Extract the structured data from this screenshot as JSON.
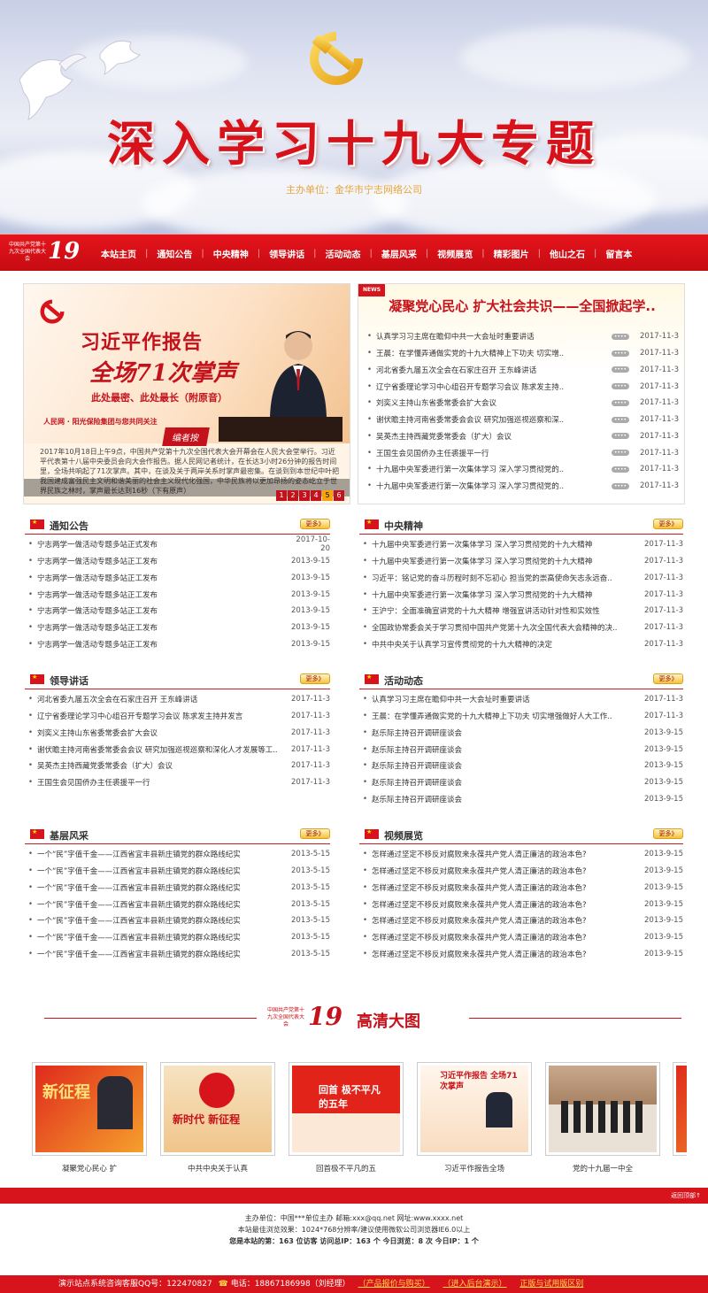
{
  "banner": {
    "title": "深入学习十九大专题",
    "sponsor": "主办单位：金华市宁志网络公司"
  },
  "nav": {
    "logo_text": "中国共产党第十九次全国代表大会",
    "logo_num": "19",
    "items": [
      "本站主页",
      "通知公告",
      "中央精神",
      "领导讲话",
      "活动动态",
      "基层风采",
      "视频展览",
      "精彩图片",
      "他山之石",
      "留言本"
    ]
  },
  "slider": {
    "headline1": "习近平作报告",
    "headline2": "全场71次掌声",
    "headline3": "此处最密、此处最长（附原音）",
    "source": "人民网 · 阳光保险集团与您共同关注",
    "tag": "编者按",
    "text": "2017年10月18日上午9点，中国共产党第十九次全国代表大会开幕会在人民大会堂举行。习近平代表第十八届中央委员会向大会作报告。据人民网记者统计，在长达3小时26分钟的报告时间里，全场共响起了71次掌声。其中，在谈及关于两岸关系时掌声最密集。在谈到到本世纪中叶把我国建成富强民主文明和谐美丽的社会主义现代化强国，中华民族将以更加昂扬的姿态屹立于世界民族之林时，掌声最长达到16秒（下有原声）",
    "pages": [
      "1",
      "2",
      "3",
      "4",
      "5",
      "6"
    ]
  },
  "news": {
    "badge": "NEWS",
    "title": "凝聚党心民心 扩大社会共识——全国掀起学..",
    "items": [
      {
        "title": "认真学习习主席在瞻仰中共一大会址时重要讲话",
        "date": "2017-11-3"
      },
      {
        "title": "王晨：在学懂弄通做实党的十九大精神上下功夫  切实增..",
        "date": "2017-11-3"
      },
      {
        "title": "河北省委九届五次全会在石家庄召开  王东峰讲话",
        "date": "2017-11-3"
      },
      {
        "title": "辽宁省委理论学习中心组召开专题学习会议  陈求发主持..",
        "date": "2017-11-3"
      },
      {
        "title": "刘奕义主持山东省委常委会扩大会议",
        "date": "2017-11-3"
      },
      {
        "title": "谢伏瞻主持河南省委常委会会议  研究加强巡视巡察和深..",
        "date": "2017-11-3"
      },
      {
        "title": "吴英杰主持西藏党委常委会（扩大）会议",
        "date": "2017-11-3"
      },
      {
        "title": "王国生会见国侨办主任裘援平一行",
        "date": "2017-11-3"
      },
      {
        "title": "十九届中央军委进行第一次集体学习  深入学习贯彻党的..",
        "date": "2017-11-3"
      },
      {
        "title": "十九届中央军委进行第一次集体学习  深入学习贯彻党的..",
        "date": "2017-11-3"
      }
    ]
  },
  "sections": {
    "more_label": "更多》",
    "notice": {
      "title": "通知公告",
      "items": [
        {
          "title": "宁志两学一做活动专题多站正式发布",
          "date": "2017-10-20"
        },
        {
          "title": "宁志两学一做活动专题多站正工发布",
          "date": "2013-9-15"
        },
        {
          "title": "宁志两学一做活动专题多站正工发布",
          "date": "2013-9-15"
        },
        {
          "title": "宁志两学一做活动专题多站正工发布",
          "date": "2013-9-15"
        },
        {
          "title": "宁志两学一做活动专题多站正工发布",
          "date": "2013-9-15"
        },
        {
          "title": "宁志两学一做活动专题多站正工发布",
          "date": "2013-9-15"
        },
        {
          "title": "宁志两学一做活动专题多站正工发布",
          "date": "2013-9-15"
        }
      ]
    },
    "central": {
      "title": "中央精神",
      "items": [
        {
          "title": "十九届中央军委进行第一次集体学习  深入学习贯彻党的十九大精神",
          "date": "2017-11-3"
        },
        {
          "title": "十九届中央军委进行第一次集体学习  深入学习贯彻党的十九大精神",
          "date": "2017-11-3"
        },
        {
          "title": "习近平：铭记党的奋斗历程时刻不忘初心  担当党的崇高使命矢志永远奋..",
          "date": "2017-11-3"
        },
        {
          "title": "十九届中央军委进行第一次集体学习  深入学习贯彻党的十九大精神",
          "date": "2017-11-3"
        },
        {
          "title": "王沪宁：全面准确宣讲党的十九大精神  增强宣讲活动针对性和实效性",
          "date": "2017-11-3"
        },
        {
          "title": "全国政协常委会关于学习贯彻中国共产党第十九次全国代表大会精神的决..",
          "date": "2017-11-3"
        },
        {
          "title": "中共中央关于认真学习宣传贯彻党的十九大精神的决定",
          "date": "2017-11-3"
        }
      ]
    },
    "leaders": {
      "title": "领导讲话",
      "items": [
        {
          "title": "河北省委九届五次全会在石家庄召开  王东峰讲话",
          "date": "2017-11-3"
        },
        {
          "title": "辽宁省委理论学习中心组召开专题学习会议  陈求发主持并发言",
          "date": "2017-11-3"
        },
        {
          "title": "刘奕义主持山东省委常委会扩大会议",
          "date": "2017-11-3"
        },
        {
          "title": "谢伏瞻主持河南省委常委会会议  研究加强巡视巡察和深化人才发展等工..",
          "date": "2017-11-3"
        },
        {
          "title": "吴英杰主持西藏党委常委会（扩大）会议",
          "date": "2017-11-3"
        },
        {
          "title": "王国生会见国侨办主任裘援平一行",
          "date": "2017-11-3"
        }
      ]
    },
    "activity": {
      "title": "活动动态",
      "items": [
        {
          "title": "认真学习习主席在瞻仰中共一大会址时重要讲话",
          "date": "2017-11-3"
        },
        {
          "title": "王晨：在学懂弄通做实党的十九大精神上下功夫  切实增强做好人大工作..",
          "date": "2017-11-3"
        },
        {
          "title": "赵乐际主持召开调研座谈会",
          "date": "2013-9-15"
        },
        {
          "title": "赵乐际主持召开调研座谈会",
          "date": "2013-9-15"
        },
        {
          "title": "赵乐际主持召开调研座谈会",
          "date": "2013-9-15"
        },
        {
          "title": "赵乐际主持召开调研座谈会",
          "date": "2013-9-15"
        },
        {
          "title": "赵乐际主持召开调研座谈会",
          "date": "2013-9-15"
        }
      ]
    },
    "grassroots": {
      "title": "基层风采",
      "items": [
        {
          "title": "一个“民”字值千金——江西省宜丰县新庄镇党的群众路线纪实",
          "date": "2013-5-15"
        },
        {
          "title": "一个“民”字值千金——江西省宜丰县新庄镇党的群众路线纪实",
          "date": "2013-5-15"
        },
        {
          "title": "一个“民”字值千金——江西省宜丰县新庄镇党的群众路线纪实",
          "date": "2013-5-15"
        },
        {
          "title": "一个“民”字值千金——江西省宜丰县新庄镇党的群众路线纪实",
          "date": "2013-5-15"
        },
        {
          "title": "一个“民”字值千金——江西省宜丰县新庄镇党的群众路线纪实",
          "date": "2013-5-15"
        },
        {
          "title": "一个“民”字值千金——江西省宜丰县新庄镇党的群众路线纪实",
          "date": "2013-5-15"
        },
        {
          "title": "一个“民”字值千金——江西省宜丰县新庄镇党的群众路线纪实",
          "date": "2013-5-15"
        }
      ]
    },
    "video": {
      "title": "视频展览",
      "items": [
        {
          "title": "怎样通过坚定不移反对腐败来永葆共产党人清正廉洁的政治本色?",
          "date": "2013-9-15"
        },
        {
          "title": "怎样通过坚定不移反对腐败来永葆共产党人清正廉洁的政治本色?",
          "date": "2013-9-15"
        },
        {
          "title": "怎样通过坚定不移反对腐败来永葆共产党人清正廉洁的政治本色?",
          "date": "2013-9-15"
        },
        {
          "title": "怎样通过坚定不移反对腐败来永葆共产党人清正廉洁的政治本色?",
          "date": "2013-9-15"
        },
        {
          "title": "怎样通过坚定不移反对腐败来永葆共产党人清正廉洁的政治本色?",
          "date": "2013-9-15"
        },
        {
          "title": "怎样通过坚定不移反对腐败来永葆共产党人清正廉洁的政治本色?",
          "date": "2013-9-15"
        },
        {
          "title": "怎样通过坚定不移反对腐败来永葆共产党人清正廉洁的政治本色?",
          "date": "2013-9-15"
        }
      ]
    }
  },
  "gallery": {
    "logo_text": "中国共产党第十九次全国代表大会",
    "logo_num": "19",
    "title": "高清大图",
    "items": [
      {
        "caption": "凝聚党心民心 扩",
        "img_text": "新征程"
      },
      {
        "caption": "中共中央关于认真",
        "img_text": "新时代 新征程"
      },
      {
        "caption": "回首极不平凡的五",
        "img_text": "回首 极不平凡的五年"
      },
      {
        "caption": "习近平作报告全场",
        "img_text": "习近平作报告 全场71次掌声"
      },
      {
        "caption": "党的十九届一中全",
        "img_text": ""
      }
    ]
  },
  "footer": {
    "back_top": "返回顶部↑",
    "line1": "主办单位：中国***单位主办  邮箱:xxx@qq.net  网址:www.xxxx.net",
    "line2": "本站最佳浏览效果：1024*768分辨率/建议使用微软公司浏览器IE6.0以上",
    "line3": "您是本站的第：163 位访客    访问总IP：163 个    今日浏览：8 次    今日IP：1 个",
    "bottom": {
      "qq": "演示站点系统咨询客服QQ号：122470827",
      "phone": "电话：18867186998（刘经理）",
      "link1": "（产品报价与购买）",
      "link2": "（进入后台演示）",
      "link3": "正版与试用版区别"
    }
  }
}
